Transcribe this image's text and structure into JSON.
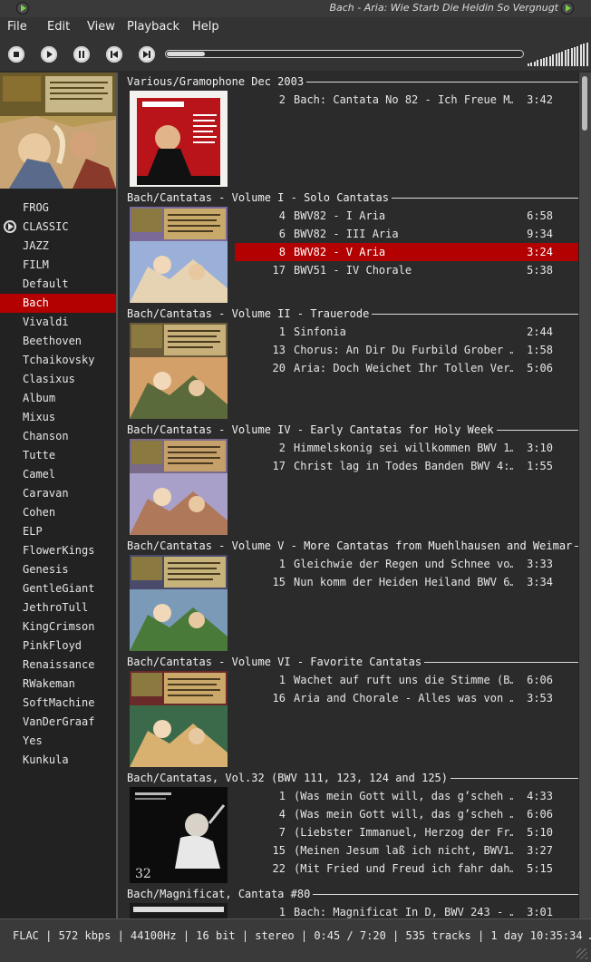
{
  "window": {
    "title": "Bach - Aria: Wie Starb Die Heldin So Vergnugt",
    "app_icon": "play-circle-icon"
  },
  "menu": [
    "File",
    "Edit",
    "View",
    "Playback",
    "Help"
  ],
  "toolbar": {
    "buttons": [
      "stop-icon",
      "play-icon",
      "pause-icon",
      "previous-icon",
      "next-icon"
    ],
    "seek_fraction": 0.107,
    "volume_fraction": 1.0
  },
  "sidebar": {
    "playing_index": 1,
    "selected_index": 5,
    "items": [
      "FROG",
      "CLASSIC",
      "JAZZ",
      "FILM",
      "Default",
      "Bach",
      "Vivaldi",
      "Beethoven",
      "Tchaikovsky",
      "Clasixus",
      "Album",
      "Mixus",
      "Chanson",
      "Tutte",
      "Camel",
      "Caravan",
      "Cohen",
      "ELP",
      "FlowerKings",
      "Genesis",
      "GentleGiant",
      "JethroTull",
      "KingCrimson",
      "PinkFloyd",
      "Renaissance",
      "RWakeman",
      "SoftMachine",
      "VanDerGraaf",
      "Yes",
      "Kunkula"
    ]
  },
  "albums": [
    {
      "title": "Various/Gramophone Dec 2003",
      "cover": "gramophone",
      "tracks": [
        {
          "no": "2",
          "name": "Bach: Cantata No 82 - Ich Freue M…",
          "len": "3:42"
        }
      ]
    },
    {
      "title": "Bach/Cantatas - Volume I - Solo Cantatas",
      "cover": "bach1",
      "tracks": [
        {
          "no": "4",
          "name": "BWV82 - I Aria",
          "len": "6:58"
        },
        {
          "no": "6",
          "name": "BWV82 - III Aria",
          "len": "9:34"
        },
        {
          "no": "8",
          "name": "BWV82 - V Aria",
          "len": "3:24",
          "selected": true
        },
        {
          "no": "17",
          "name": "BWV51 - IV Chorale",
          "len": "5:38"
        }
      ]
    },
    {
      "title": "Bach/Cantatas - Volume II - Trauerode",
      "cover": "bach2",
      "tracks": [
        {
          "no": "1",
          "name": "Sinfonia",
          "len": "2:44"
        },
        {
          "no": "13",
          "name": "Chorus: An Dir Du Furbild Grober …",
          "len": "1:58"
        },
        {
          "no": "20",
          "name": "Aria: Doch Weichet Ihr Tollen Ver…",
          "len": "5:06"
        }
      ]
    },
    {
      "title": "Bach/Cantatas - Volume IV - Early Cantatas for Holy Week",
      "cover": "bach4",
      "tracks": [
        {
          "no": "2",
          "name": "Himmelskonig sei willkommen BWV 1…",
          "len": "3:10"
        },
        {
          "no": "17",
          "name": "Christ lag in Todes Banden BWV 4:…",
          "len": "1:55"
        }
      ]
    },
    {
      "title": "Bach/Cantatas - Volume V - More Cantatas from Muehlhausen and Weimar",
      "cover": "bach5",
      "tracks": [
        {
          "no": "1",
          "name": "Gleichwie der Regen und Schnee vo…",
          "len": "3:33"
        },
        {
          "no": "15",
          "name": "Nun komm der Heiden Heiland BWV 6…",
          "len": "3:34"
        }
      ]
    },
    {
      "title": "Bach/Cantatas - Volume VI - Favorite Cantatas",
      "cover": "bach6",
      "tracks": [
        {
          "no": "1",
          "name": "Wachet auf ruft uns die Stimme (B…",
          "len": "6:06"
        },
        {
          "no": "16",
          "name": "Aria and Chorale - Alles was von …",
          "len": "3:53"
        }
      ]
    },
    {
      "title": "Bach/Cantatas, Vol.32 (BWV 111, 123, 124 and 125)",
      "cover": "bach32",
      "cover_number": "32",
      "tracks": [
        {
          "no": "1",
          "name": "(Was mein Gott will, das g’scheh …",
          "len": "4:33"
        },
        {
          "no": "4",
          "name": "(Was mein Gott will, das g’scheh …",
          "len": "6:06"
        },
        {
          "no": "7",
          "name": "(Liebster Immanuel, Herzog der Fr…",
          "len": "5:10"
        },
        {
          "no": "15",
          "name": "(Meinen Jesum laß ich nicht, BWV1…",
          "len": "3:27"
        },
        {
          "no": "22",
          "name": "(Mit Fried und Freud ich fahr dah…",
          "len": "5:15"
        }
      ]
    },
    {
      "title": "Bach/Magnificat, Cantata #80",
      "cover": "magnificat",
      "tracks": [
        {
          "no": "1",
          "name": "Bach: Magnificat In D, BWV 243 - …",
          "len": "3:01"
        }
      ]
    }
  ],
  "status": {
    "text": "FLAC | 572 kbps | 44100Hz | 16 bit | stereo | 0:45 / 7:20 | 535 tracks | 1 day 10:35:34 …"
  }
}
